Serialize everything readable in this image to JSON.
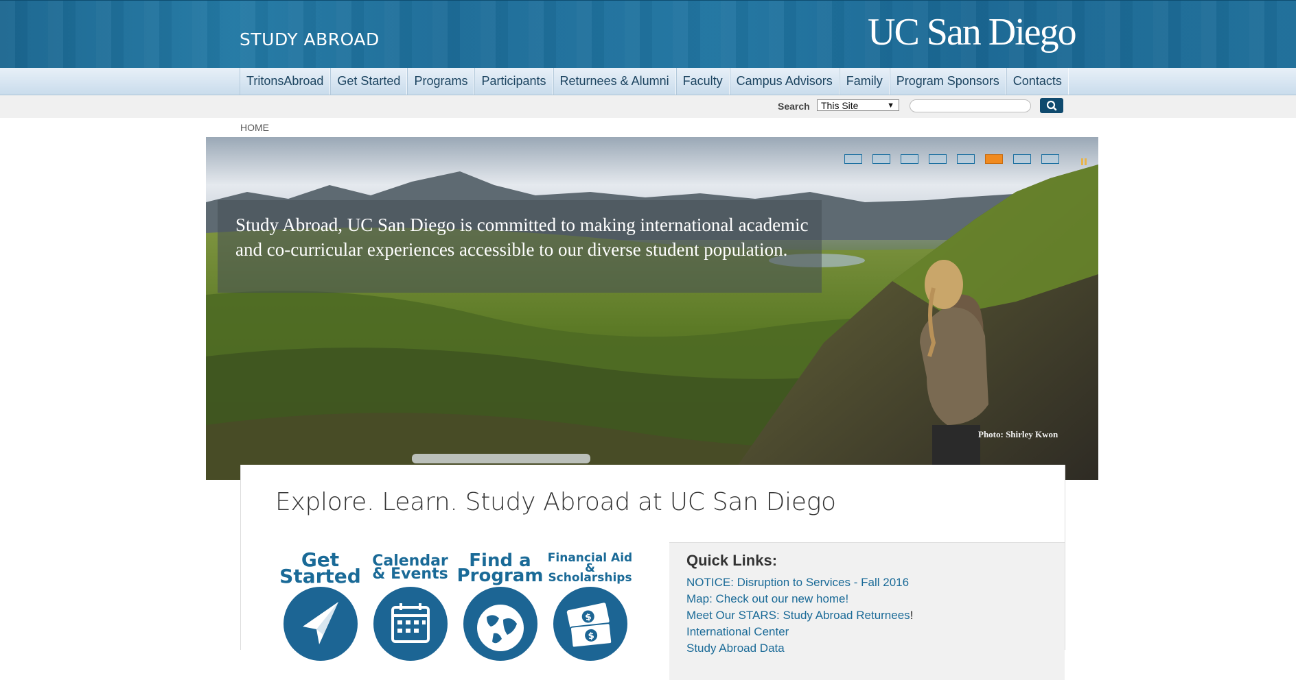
{
  "header": {
    "site_title": "STUDY ABROAD",
    "logo_text": "UC San Diego"
  },
  "nav": {
    "items": [
      {
        "label": "TritonsAbroad"
      },
      {
        "label": "Get Started"
      },
      {
        "label": "Programs"
      },
      {
        "label": "Participants"
      },
      {
        "label": "Returnees & Alumni"
      },
      {
        "label": "Faculty"
      },
      {
        "label": "Campus Advisors"
      },
      {
        "label": "Family"
      },
      {
        "label": "Program Sponsors"
      },
      {
        "label": "Contacts"
      }
    ]
  },
  "search": {
    "label": "Search",
    "scope_selected": "This Site",
    "query": "",
    "button_icon": "search-icon"
  },
  "breadcrumb": {
    "home": "HOME"
  },
  "hero": {
    "caption": "Study Abroad, UC San Diego is committed to making international academic and co-curricular experiences accessible to our diverse student population.",
    "photo_credit": "Photo: Shirley Kwon",
    "slide_count": 8,
    "active_slide": 6,
    "active_color": "#f08a1f"
  },
  "main": {
    "title": "Explore. Learn. Study Abroad at UC San Diego",
    "tiles": [
      {
        "label_line1": "Get",
        "label_line2": "Started",
        "icon": "paper-plane-icon"
      },
      {
        "label_line1": "Calendar",
        "label_line2": "& Events",
        "icon": "calendar-icon"
      },
      {
        "label_line1": "Find a",
        "label_line2": "Program",
        "icon": "globe-icon"
      },
      {
        "label_line1": "Financial Aid",
        "label_line2": "& Scholarships",
        "icon": "money-icon"
      }
    ]
  },
  "quick_links": {
    "title": "Quick Links:",
    "items": [
      {
        "label": "NOTICE: Disruption to Services - Fall 2016",
        "suffix": ""
      },
      {
        "label": "Map: Check out our new home!",
        "suffix": ""
      },
      {
        "label": "Meet Our STARS: Study Abroad Returnees",
        "suffix": "!"
      },
      {
        "label": "International Center",
        "suffix": ""
      },
      {
        "label": "Study Abroad Data",
        "suffix": ""
      }
    ]
  },
  "colors": {
    "brand_blue": "#1a6a97",
    "header_blue": "#1f70a0",
    "search_button": "#0f4a6e"
  }
}
